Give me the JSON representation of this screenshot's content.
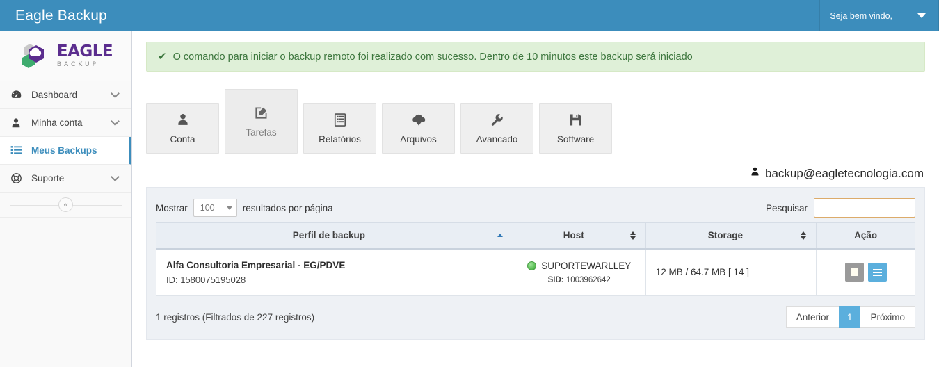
{
  "header": {
    "app_title": "Eagle Backup",
    "user_menu_label": "Seja bem vindo,",
    "bar_color": "#3c8dbc"
  },
  "sidebar": {
    "logo": {
      "primary": "EAGLE",
      "secondary": "BACKUP",
      "purple": "#5b2d8e",
      "green": "#3eab6e"
    },
    "items": [
      {
        "label": "Dashboard",
        "icon": "dashboard-icon",
        "active": false,
        "has_chevron": true
      },
      {
        "label": "Minha conta",
        "icon": "user-icon",
        "active": false,
        "has_chevron": true
      },
      {
        "label": "Meus Backups",
        "icon": "list-icon",
        "active": true,
        "has_chevron": false
      },
      {
        "label": "Suporte",
        "icon": "lifebuoy-icon",
        "active": false,
        "has_chevron": true
      }
    ],
    "collapse_glyph": "«"
  },
  "alert": {
    "icon": "check-icon",
    "message": "O comando para iniciar o backup remoto foi realizado com sucesso. Dentro de 10 minutos este backup será iniciado",
    "bg": "#dff0d8",
    "text_color": "#3c763d"
  },
  "tabs": [
    {
      "label": "Conta",
      "icon": "person-icon",
      "active": false
    },
    {
      "label": "Tarefas",
      "icon": "edit-square-icon",
      "active": true
    },
    {
      "label": "Relatórios",
      "icon": "report-list-icon",
      "active": false
    },
    {
      "label": "Arquivos",
      "icon": "cloud-download-icon",
      "active": false
    },
    {
      "label": "Avancado",
      "icon": "wrench-icon",
      "active": false
    },
    {
      "label": "Software",
      "icon": "floppy-save-icon",
      "active": false
    }
  ],
  "account": {
    "icon": "user-icon",
    "email": "backup@eagletecnologia.com"
  },
  "table_controls": {
    "show_label": "Mostrar",
    "page_size_value": "100",
    "per_page_label": "resultados por página",
    "search_label": "Pesquisar",
    "search_value": "",
    "search_placeholder": "",
    "search_border_color": "#dcab6a"
  },
  "table": {
    "columns": [
      {
        "label": "Perfil de backup",
        "sorted": "asc"
      },
      {
        "label": "Host",
        "sorted": "none"
      },
      {
        "label": "Storage",
        "sorted": "none"
      },
      {
        "label": "Ação",
        "sorted": "none"
      }
    ],
    "rows": [
      {
        "profile_name": "Alfa Consultoria Empresarial - EG/PDVE",
        "profile_id": "ID: 1580075195028",
        "host_status": "online",
        "host_name": "SUPORTEWARLLEY",
        "host_sid_label": "SID:",
        "host_sid_value": "1003962642",
        "storage": "12 MB / 64.7 MB [ 14 ]",
        "actions": [
          {
            "name": "stop-button",
            "color": "#9a9a9a"
          },
          {
            "name": "menu-button",
            "color": "#5bafdd"
          }
        ]
      }
    ]
  },
  "footer": {
    "records_info": "1 registros (Filtrados de 227 registros)",
    "pagination": {
      "previous": "Anterior",
      "current_page": "1",
      "next": "Próximo"
    }
  }
}
